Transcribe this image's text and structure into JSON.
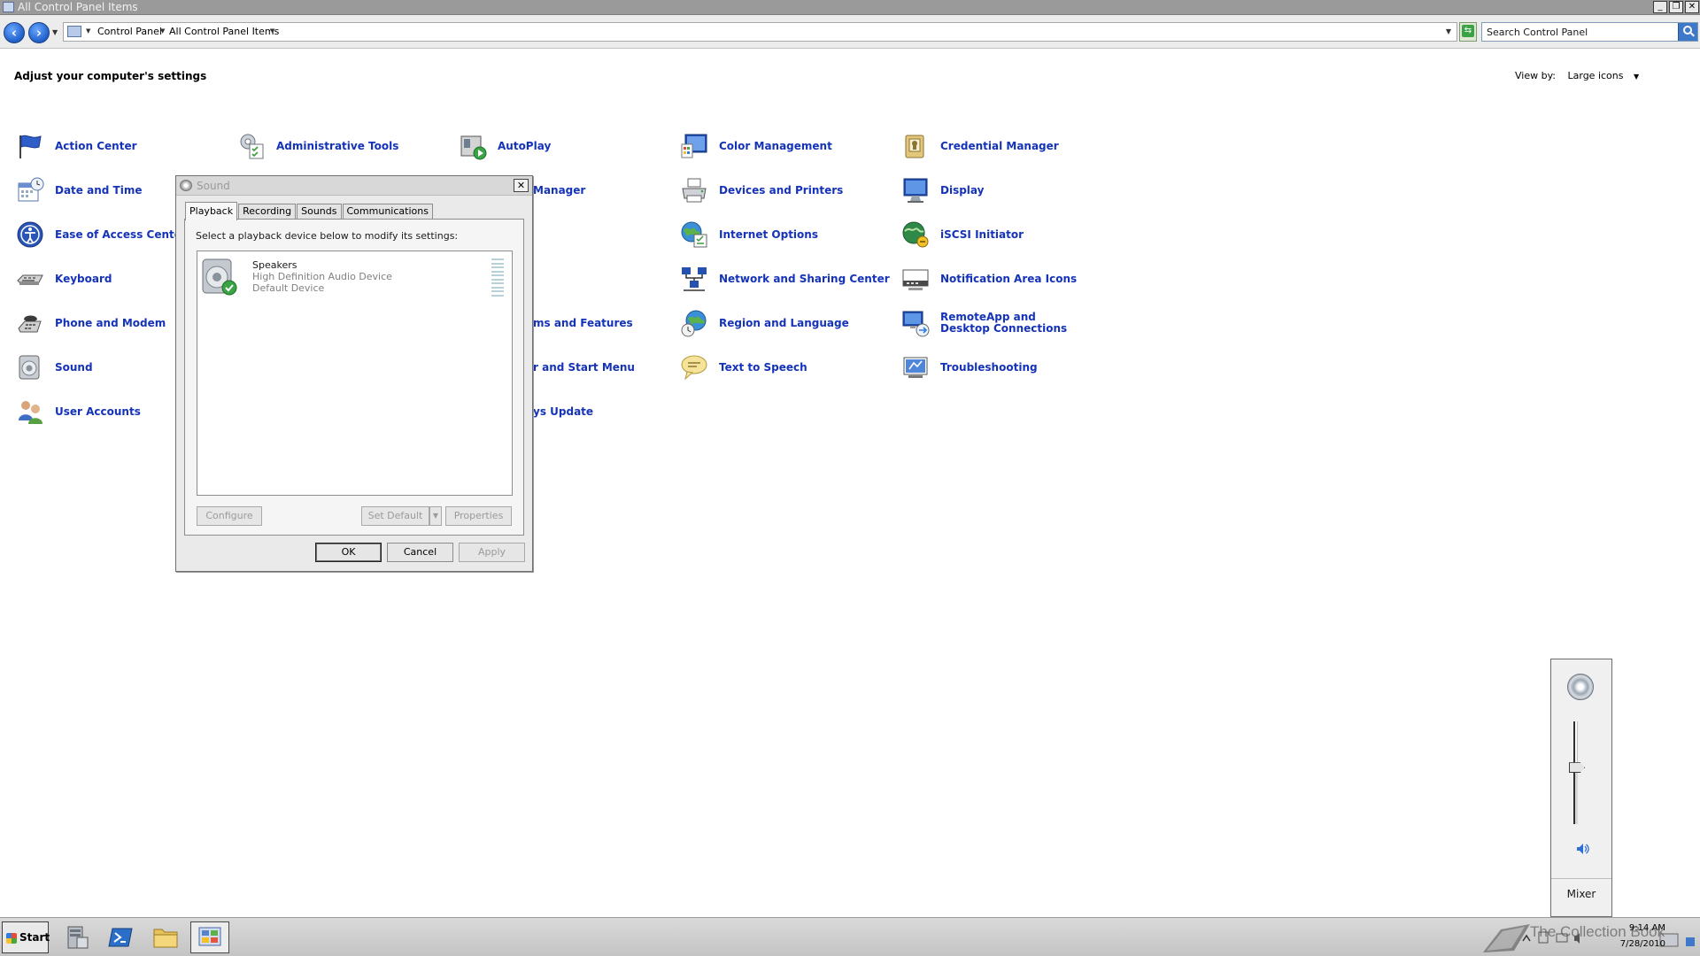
{
  "window": {
    "title": "All Control Panel Items",
    "buttons": {
      "minimize": "_",
      "restore": "❐",
      "close": "✕"
    }
  },
  "address_bar": {
    "back_icon": "back-arrow-icon",
    "forward_icon": "forward-arrow-icon",
    "crumbs": [
      "Control Panel",
      "All Control Panel Items"
    ],
    "search_placeholder": "Search Control Panel"
  },
  "content": {
    "title": "Adjust your computer's settings",
    "view_by_label": "View by:",
    "view_by_value": "Large icons"
  },
  "items": [
    {
      "label": "Action Center",
      "icon": "flag-icon"
    },
    {
      "label": "Administrative Tools",
      "icon": "admin-tools-icon"
    },
    {
      "label": "AutoPlay",
      "icon": "autoplay-icon"
    },
    {
      "label": "Color Management",
      "icon": "color-management-icon"
    },
    {
      "label": "Credential Manager",
      "icon": "credential-manager-icon"
    },
    {
      "label": "Date and Time",
      "icon": "calendar-clock-icon"
    },
    {
      "label": "Manager",
      "icon": "device-manager-icon"
    },
    {
      "label": "Devices and Printers",
      "icon": "printer-icon"
    },
    {
      "label": "Display",
      "icon": "monitor-icon"
    },
    {
      "label": "Ease of Access Center",
      "icon": "ease-of-access-icon"
    },
    {
      "label": "Internet Options",
      "icon": "internet-options-icon"
    },
    {
      "label": "iSCSI Initiator",
      "icon": "iscsi-globe-icon"
    },
    {
      "label": "Keyboard",
      "icon": "keyboard-icon"
    },
    {
      "label": "Network and Sharing Center",
      "icon": "network-icon"
    },
    {
      "label": "Notification Area Icons",
      "icon": "notification-area-icon"
    },
    {
      "label": "Phone and Modem",
      "icon": "phone-icon"
    },
    {
      "label": "ms and Features",
      "icon": "programs-icon"
    },
    {
      "label": "Region and Language",
      "icon": "region-globe-icon"
    },
    {
      "label": "RemoteApp and Desktop Connections",
      "icon": "remoteapp-icon"
    },
    {
      "label": "Sound",
      "icon": "speaker-icon"
    },
    {
      "label": "r and Start Menu",
      "icon": "taskbar-icon"
    },
    {
      "label": "Text to Speech",
      "icon": "speech-bubble-icon"
    },
    {
      "label": "Troubleshooting",
      "icon": "troubleshooting-icon"
    },
    {
      "label": "User Accounts",
      "icon": "users-icon"
    },
    {
      "label": "ys Update",
      "icon": "windows-update-icon"
    }
  ],
  "dialog": {
    "title": "Sound",
    "close": "✕",
    "tabs": [
      "Playback",
      "Recording",
      "Sounds",
      "Communications"
    ],
    "instruction": "Select a playback device below to modify its settings:",
    "device": {
      "name": "Speakers",
      "description": "High Definition Audio Device",
      "status": "Default Device"
    },
    "buttons": {
      "configure": "Configure",
      "set_default": "Set Default",
      "set_default_drop": "▼",
      "properties": "Properties",
      "ok": "OK",
      "cancel": "Cancel",
      "apply": "Apply"
    }
  },
  "volume": {
    "level": 0.55,
    "mixer_label": "Mixer"
  },
  "taskbar": {
    "start_label": "Start",
    "watermark": "The Collection Book",
    "time": "9:14 AM",
    "date": "7/28/2010"
  },
  "colors": {
    "link_blue": "#1433b8",
    "titlebar_gray": "#9a9a9a",
    "accent_blue": "#1e5fc8"
  }
}
